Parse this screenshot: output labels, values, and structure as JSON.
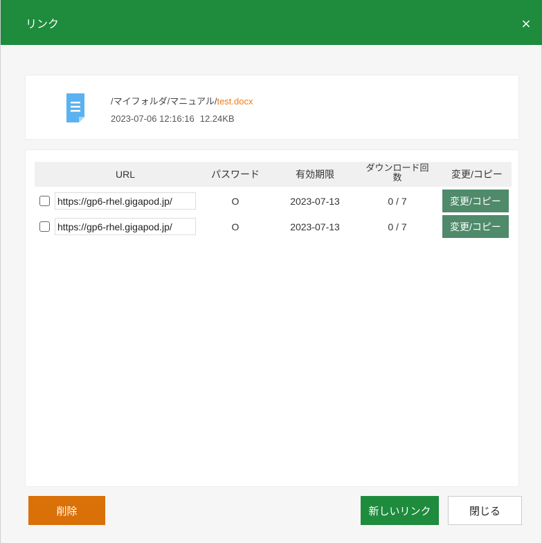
{
  "dialog": {
    "title": "リンク",
    "close_glyph": "×"
  },
  "file": {
    "path_prefix": "/マイフォルダ/マニュアル/",
    "name": "test.docx",
    "date": "2023-07-06 12:16:16",
    "size": "12.24KB",
    "icon": "document-icon"
  },
  "table": {
    "headers": {
      "url": "URL",
      "password": "パスワード",
      "expiry": "有効期限",
      "downloads": "ダウンロード回数",
      "action": "変更/コピー"
    },
    "rows": [
      {
        "url": "https://gp6-rhel.gigapod.jp/",
        "password": "O",
        "expiry": "2023-07-13",
        "downloads": "0 / 7",
        "action": "変更/コピー",
        "checked": false
      },
      {
        "url": "https://gp6-rhel.gigapod.jp/",
        "password": "O",
        "expiry": "2023-07-13",
        "downloads": "0 / 7",
        "action": "変更/コピー",
        "checked": false
      }
    ]
  },
  "buttons": {
    "delete": "削除",
    "new_link": "新しいリンク",
    "close": "閉じる"
  },
  "colors": {
    "brand_green": "#1e8b3d",
    "delete_orange": "#d97008",
    "action_green": "#4f8a6a",
    "filename_orange": "#f07b15",
    "icon_blue": "#5ab2f0"
  }
}
